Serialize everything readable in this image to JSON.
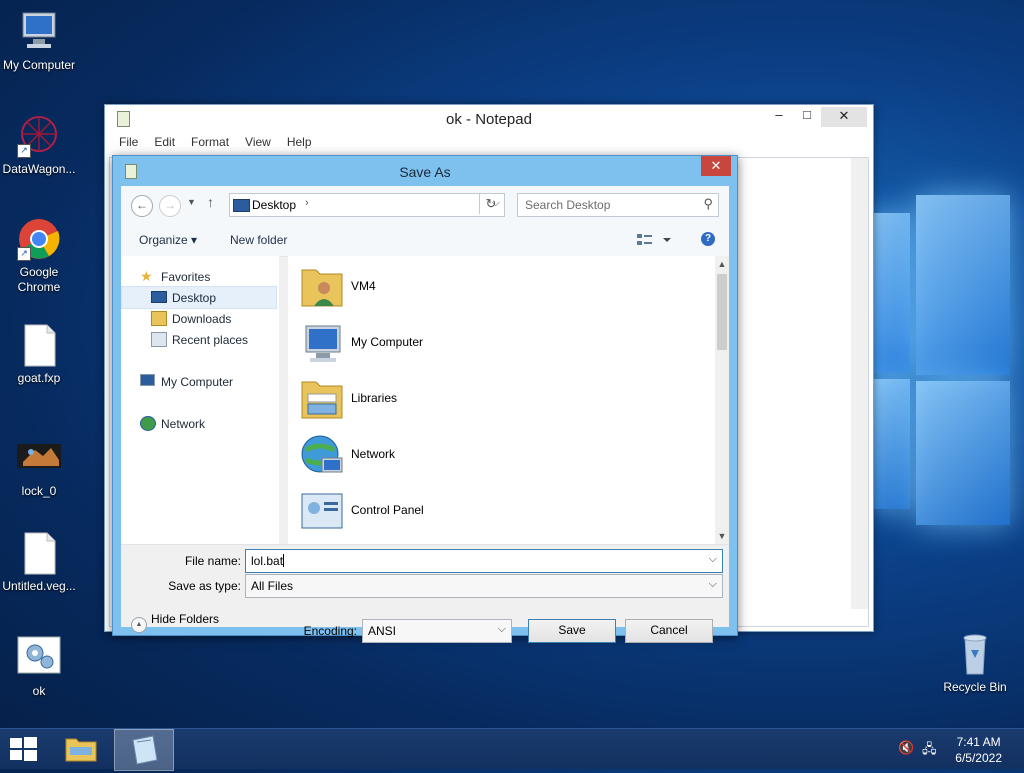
{
  "desktop": {
    "icons": [
      {
        "label": "My Computer",
        "icon": "computer-icon"
      },
      {
        "label": "DataWagon...",
        "icon": "datawagon-icon"
      },
      {
        "label": "Google Chrome",
        "icon": "chrome-icon"
      },
      {
        "label": "goat.fxp",
        "icon": "file-icon"
      },
      {
        "label": "lock_0",
        "icon": "image-file-icon"
      },
      {
        "label": "Untitled.veg...",
        "icon": "file-icon"
      },
      {
        "label": "ok",
        "icon": "settings-file-icon"
      },
      {
        "label": "Recycle Bin",
        "icon": "recycle-bin-icon"
      }
    ]
  },
  "notepad": {
    "title": "ok - Notepad",
    "menu": [
      "File",
      "Edit",
      "Format",
      "View",
      "Help"
    ],
    "controls": {
      "minimize": "–",
      "maximize": "□",
      "close": "✕"
    }
  },
  "dialog": {
    "title": "Save As",
    "close": "✕",
    "address": {
      "location": "Desktop",
      "separator": "›"
    },
    "search_placeholder": "Search Desktop",
    "toolbar": {
      "organize": "Organize ▾",
      "new_folder": "New folder"
    },
    "nav": [
      {
        "label": "Favorites",
        "icon": "star-icon"
      },
      {
        "label": "Desktop",
        "icon": "desktop-icon",
        "selected": true
      },
      {
        "label": "Downloads",
        "icon": "downloads-icon"
      },
      {
        "label": "Recent places",
        "icon": "recent-places-icon"
      },
      {
        "label": "My Computer",
        "icon": "computer-icon"
      },
      {
        "label": "Network",
        "icon": "network-icon"
      }
    ],
    "files": [
      {
        "label": "VM4",
        "icon": "user-folder-icon"
      },
      {
        "label": "My Computer",
        "icon": "computer-icon"
      },
      {
        "label": "Libraries",
        "icon": "libraries-icon"
      },
      {
        "label": "Network",
        "icon": "network-icon"
      },
      {
        "label": "Control Panel",
        "icon": "control-panel-icon"
      }
    ],
    "file_name_label": "File name:",
    "file_name_value": "lol.bat",
    "save_type_label": "Save as type:",
    "save_type_value": "All Files",
    "encoding_label": "Encoding:",
    "encoding_value": "ANSI",
    "save_button": "Save",
    "cancel_button": "Cancel",
    "hide_folders": "Hide Folders"
  },
  "taskbar": {
    "time": "7:41 AM",
    "date": "6/5/2022"
  },
  "colors": {
    "dialog_frame": "#7ec0ee",
    "close_red": "#c7463d",
    "taskbar": "#123060"
  }
}
